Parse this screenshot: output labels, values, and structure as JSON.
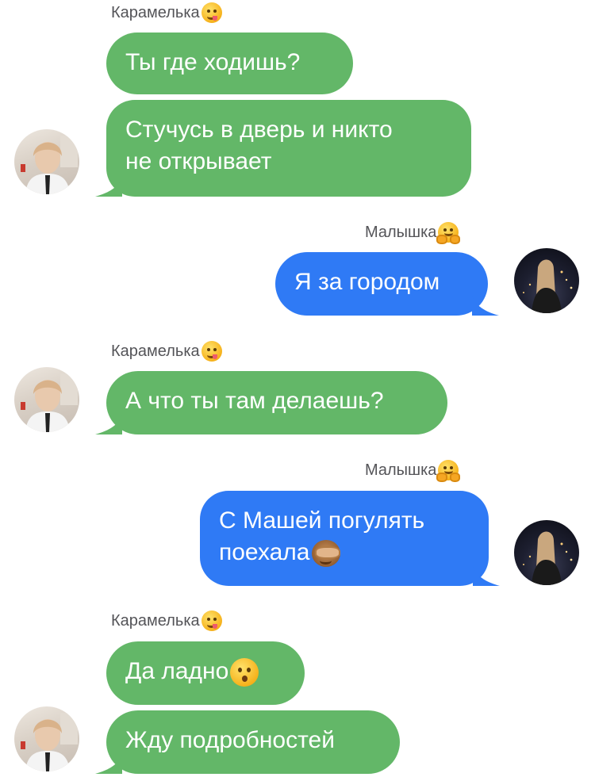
{
  "contacts": {
    "left": {
      "name": "Карамелька",
      "emoji": "yum-face-icon"
    },
    "right": {
      "name": "Малышка",
      "emoji": "hugging-face-icon"
    }
  },
  "messages": [
    {
      "sender": "Карамелька",
      "text": "Ты где ходишь?"
    },
    {
      "sender": "Карамелька",
      "text": "Стучусь в дверь и никто\nне открывает"
    },
    {
      "sender": "Малышка",
      "text": "Я за городом"
    },
    {
      "sender": "Карамелька",
      "text": "А что ты там делаешь?"
    },
    {
      "sender": "Малышка",
      "text": "С Машей погулять\nпоехала",
      "emoji": "see-no-evil-monkey-icon"
    },
    {
      "sender": "Карамелька",
      "text": "Да ладно",
      "emoji": "hushed-face-icon"
    },
    {
      "sender": "Карамелька",
      "text": "Жду подробностей"
    }
  ],
  "colors": {
    "incoming_bubble": "#63b768",
    "outgoing_bubble": "#2f7af5",
    "sender_name": "#545458",
    "background": "#ffffff"
  }
}
